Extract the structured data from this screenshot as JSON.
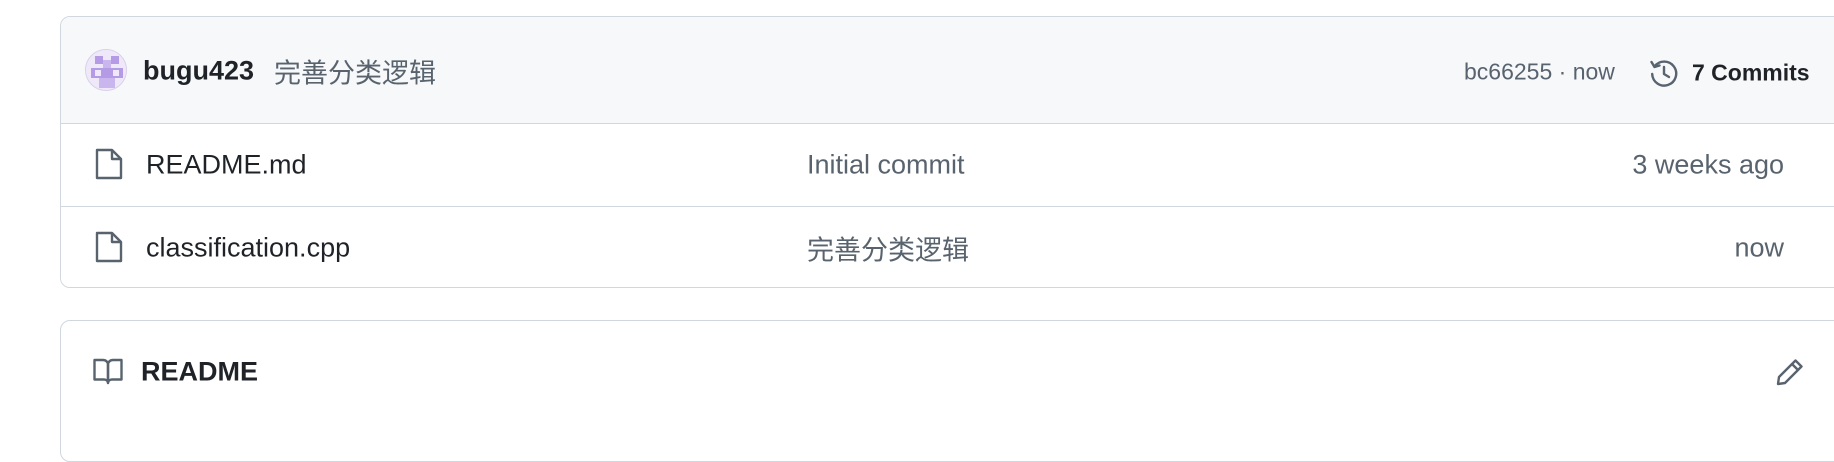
{
  "latest_commit": {
    "author": "bugu423",
    "message": "完善分类逻辑",
    "sha": "bc66255",
    "separator": " · ",
    "time": "now",
    "history_label": "7 Commits",
    "avatar_icon": "identicon-avatar",
    "history_icon": "history-clock-icon"
  },
  "files": [
    {
      "name": "README.md",
      "commit_message": "Initial commit",
      "time": "3 weeks ago",
      "icon": "file-icon"
    },
    {
      "name": "classification.cpp",
      "commit_message": "完善分类逻辑",
      "time": "now",
      "icon": "file-icon"
    }
  ],
  "readme": {
    "title": "README",
    "icon": "book-icon",
    "edit_icon": "pencil-icon"
  },
  "colors": {
    "border": "#d0d7de",
    "header_bg": "#f6f8fa",
    "text_primary": "#1f2328",
    "text_muted": "#59636e",
    "avatar_purple": "#b59be6"
  }
}
